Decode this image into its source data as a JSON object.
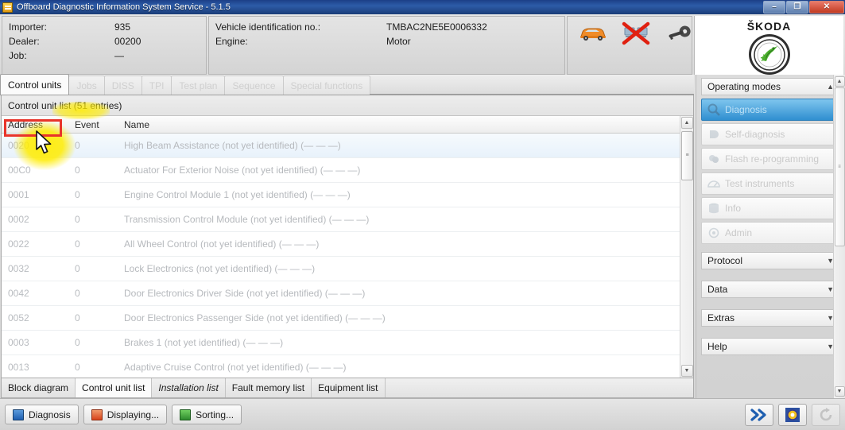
{
  "window": {
    "title": "Offboard Diagnostic Information System Service - 5.1.5",
    "minimize": "–",
    "restore": "❐",
    "close": "✕"
  },
  "header": {
    "left": [
      {
        "label": "Importer:",
        "value": "935"
      },
      {
        "label": "Dealer:",
        "value": "00200"
      },
      {
        "label": "Job:",
        "value": "—"
      }
    ],
    "right": [
      {
        "label": "Vehicle identification no.:",
        "value": "TMBAC2NE5E0006332"
      },
      {
        "label": "Engine:",
        "value": "Motor"
      }
    ],
    "status_icons": [
      "car-icon",
      "connection-disconnected-icon",
      "key-icon",
      "bluetooth-icon",
      "info-icon"
    ]
  },
  "brand": {
    "name": "ŠKODA",
    "logo": "skoda-winged-arrow-logo"
  },
  "tabs": [
    {
      "label": "Control units",
      "active": true,
      "enabled": true
    },
    {
      "label": "Jobs",
      "active": false,
      "enabled": false
    },
    {
      "label": "DISS",
      "active": false,
      "enabled": false
    },
    {
      "label": "TPI",
      "active": false,
      "enabled": false
    },
    {
      "label": "Test plan",
      "active": false,
      "enabled": false
    },
    {
      "label": "Sequence",
      "active": false,
      "enabled": false
    },
    {
      "label": "Special functions",
      "active": false,
      "enabled": false
    }
  ],
  "content": {
    "list_title": "Control unit list (51 entries)",
    "columns": [
      "Address",
      "Event",
      "Name"
    ],
    "rows": [
      {
        "address": "0020",
        "event": "0",
        "name": "High Beam Assistance (not yet identified) (—  —  —)",
        "selected": true
      },
      {
        "address": "00C0",
        "event": "0",
        "name": "Actuator For Exterior Noise (not yet identified) (—  —  —)",
        "selected": false
      },
      {
        "address": "0001",
        "event": "0",
        "name": "Engine Control Module 1 (not yet identified) (—  —  —)",
        "selected": false
      },
      {
        "address": "0002",
        "event": "0",
        "name": "Transmission Control Module (not yet identified) (—  —  —)",
        "selected": false
      },
      {
        "address": "0022",
        "event": "0",
        "name": "All Wheel Control (not yet identified) (—  —  —)",
        "selected": false
      },
      {
        "address": "0032",
        "event": "0",
        "name": "Lock Electronics (not yet identified) (—  —  —)",
        "selected": false
      },
      {
        "address": "0042",
        "event": "0",
        "name": "Door Electronics Driver Side (not yet identified) (—  —  —)",
        "selected": false
      },
      {
        "address": "0052",
        "event": "0",
        "name": "Door Electronics Passenger Side (not yet identified) (—  —  —)",
        "selected": false
      },
      {
        "address": "0003",
        "event": "0",
        "name": "Brakes 1 (not yet identified) (—  —  —)",
        "selected": false
      },
      {
        "address": "0013",
        "event": "0",
        "name": "Adaptive Cruise Control (not yet identified) (—  —  —)",
        "selected": false
      }
    ]
  },
  "subtabs": [
    {
      "label": "Block diagram",
      "active": false,
      "italic": false
    },
    {
      "label": "Control unit list",
      "active": true,
      "italic": false
    },
    {
      "label": "Installation list",
      "active": false,
      "italic": true
    },
    {
      "label": "Fault memory list",
      "active": false,
      "italic": false
    },
    {
      "label": "Equipment list",
      "active": false,
      "italic": false
    }
  ],
  "sidebar": {
    "sections": [
      {
        "title": "Operating modes",
        "chevron": "▲",
        "expanded": true
      },
      {
        "title": "Protocol",
        "chevron": "▼",
        "expanded": false
      },
      {
        "title": "Data",
        "chevron": "▼",
        "expanded": false
      },
      {
        "title": "Extras",
        "chevron": "▼",
        "expanded": false
      },
      {
        "title": "Help",
        "chevron": "▼",
        "expanded": false
      }
    ],
    "modes": [
      {
        "label": "Diagnosis",
        "icon": "diagnosis-icon",
        "selected": true
      },
      {
        "label": "Self-diagnosis",
        "icon": "self-diagnosis-icon",
        "selected": false
      },
      {
        "label": "Flash re-programming",
        "icon": "flash-icon",
        "selected": false
      },
      {
        "label": "Test instruments",
        "icon": "test-instruments-icon",
        "selected": false
      },
      {
        "label": "Info",
        "icon": "info-icon",
        "selected": false
      },
      {
        "label": "Admin",
        "icon": "admin-icon",
        "selected": false
      }
    ]
  },
  "bottom": {
    "buttons": [
      {
        "label": "Diagnosis",
        "icon": "diagnosis-square-icon",
        "color": "#2a6fc4"
      },
      {
        "label": "Displaying...",
        "icon": "display-icon",
        "color": "#d84a1b"
      },
      {
        "label": "Sorting...",
        "icon": "sorting-icon",
        "color": "#2e8b2e"
      }
    ],
    "right_icons": [
      {
        "name": "forward-double-chevron-icon",
        "enabled": true
      },
      {
        "name": "target-icon",
        "enabled": true
      },
      {
        "name": "refresh-icon",
        "enabled": false
      }
    ]
  },
  "colors": {
    "accent": "#2f8fd0",
    "highlight_box": "#e8342a",
    "highlight_glow": "#ffec00",
    "title_bar": "#2d5ca8"
  }
}
